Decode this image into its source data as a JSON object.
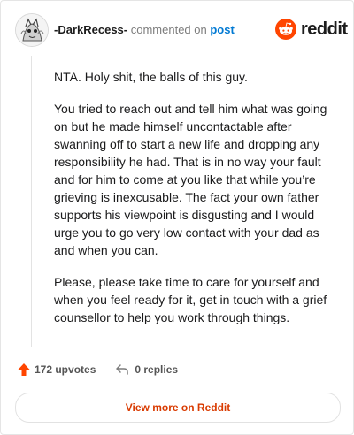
{
  "header": {
    "username": "-DarkRecess-",
    "action_text": "commented on",
    "post_link": "post",
    "brand": "reddit"
  },
  "comment": {
    "paragraphs": [
      "NTA. Holy shit, the balls of this guy.",
      "You tried to reach out and tell him what was going on but he made himself uncontactable after swanning off to start a new life and dropping any responsibility he had. That is in no way your fault and for him to come at you like that while you’re grieving is inexcusable. The fact your own father supports his viewpoint is disgusting and I would urge you to go very low contact with your dad as and when you can.",
      "Please, please take time to care for yourself and when you feel ready for it, get in touch with a grief counsellor to help you work through things."
    ]
  },
  "actions": {
    "upvotes": "172 upvotes",
    "replies": "0 replies"
  },
  "footer": {
    "view_more": "View more on Reddit"
  },
  "colors": {
    "brand_orange": "#ff4500",
    "link_blue": "#0079d3",
    "button_text": "#d93a00"
  },
  "icons": {
    "avatar": "user-avatar",
    "logo": "reddit-logo-icon",
    "upvote": "upvote-arrow-icon",
    "reply": "reply-arrow-icon"
  }
}
